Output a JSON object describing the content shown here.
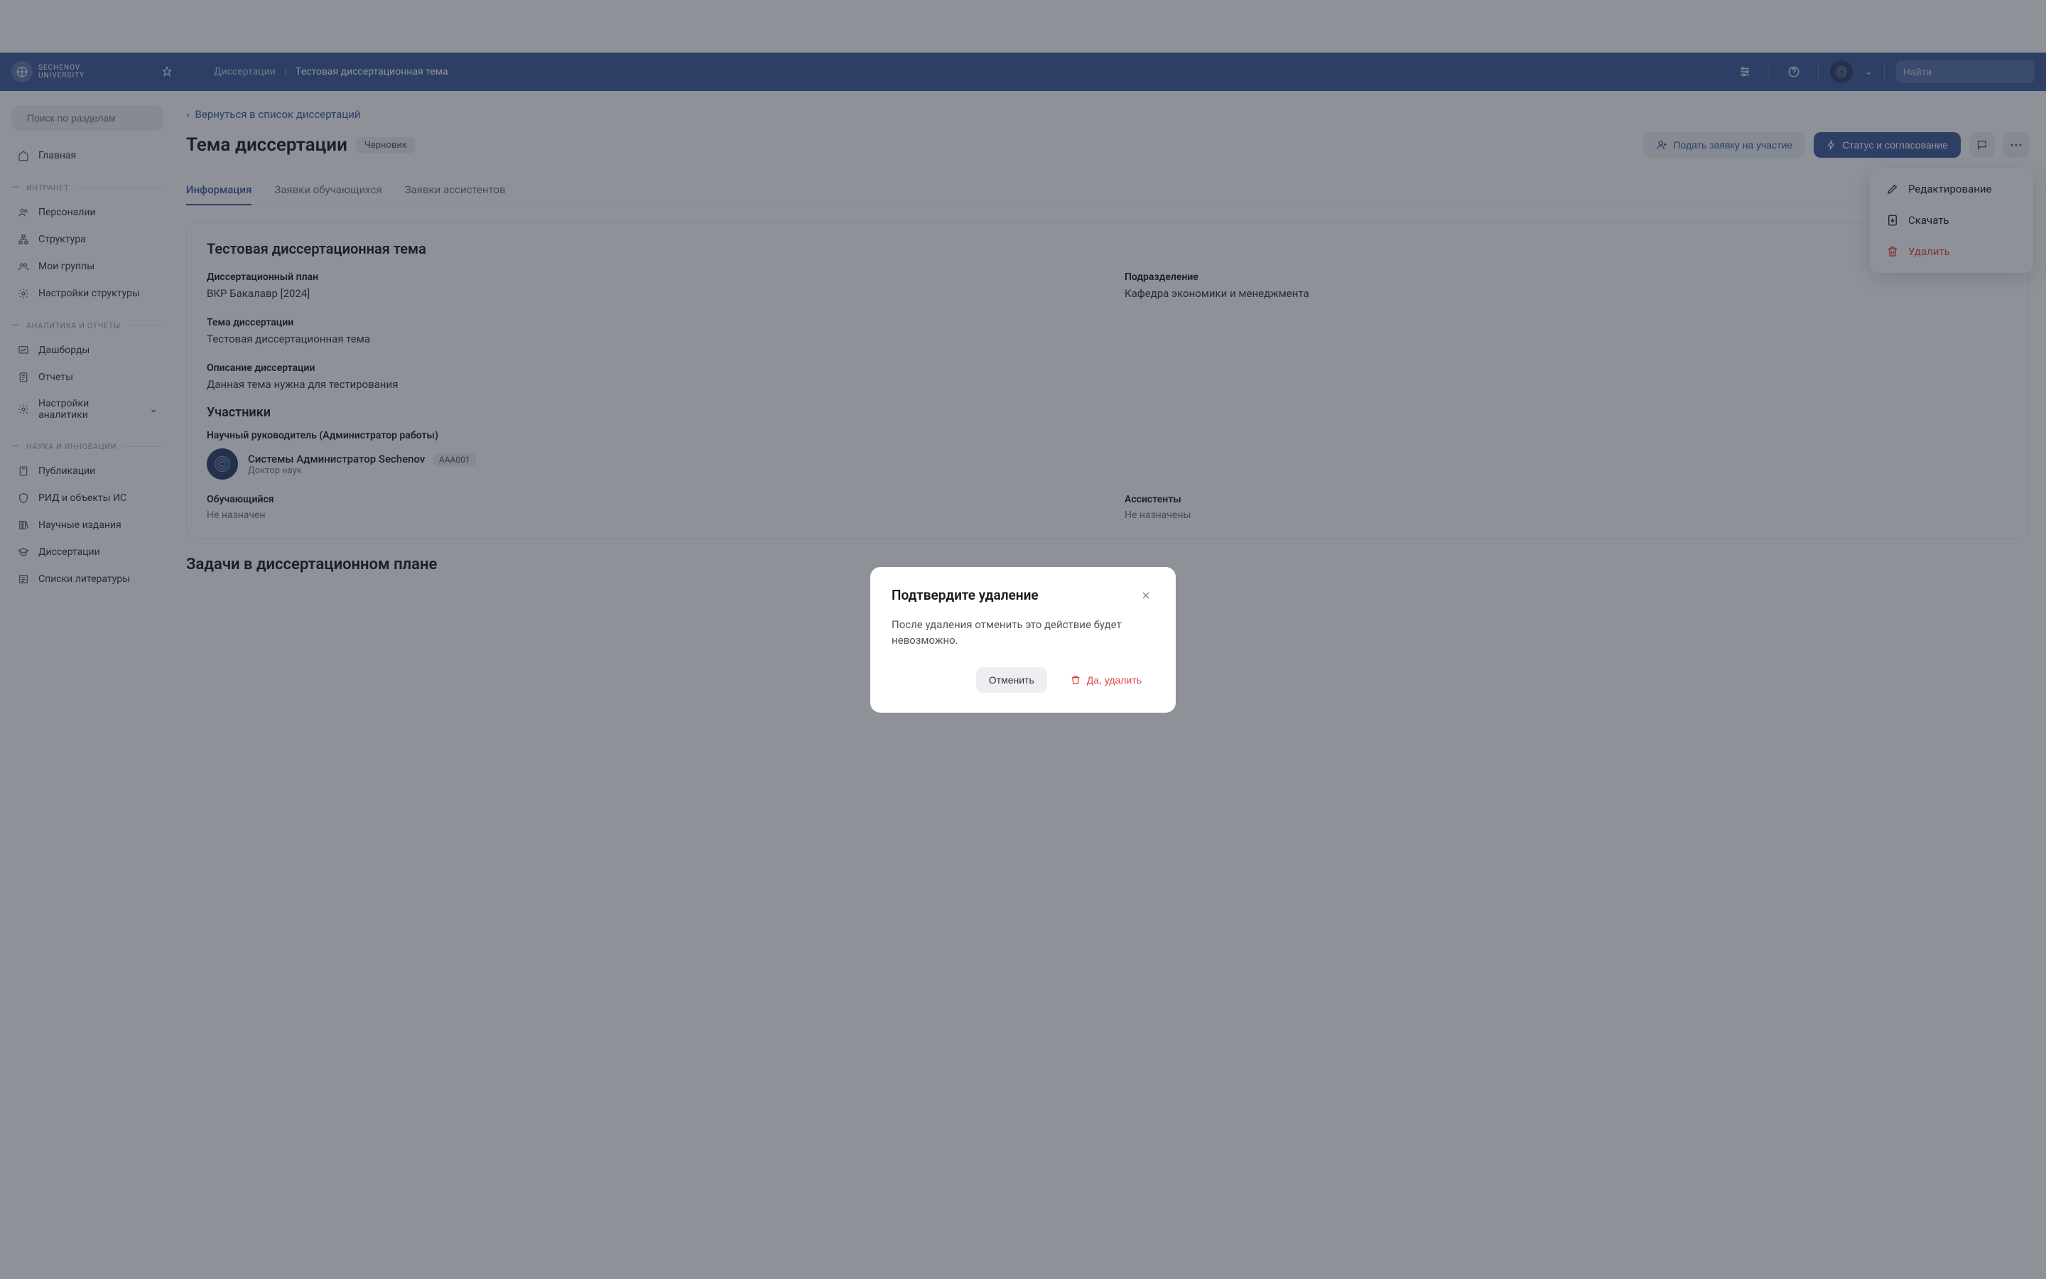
{
  "header": {
    "logo_line1": "SECHENOV",
    "logo_line2": "UNIVERSITY",
    "breadcrumb": [
      {
        "label": "Диссертации"
      },
      {
        "label": "Тестовая диссертационная тема"
      }
    ],
    "search_placeholder": "Найти"
  },
  "sidebar": {
    "search_placeholder": "Поиск по разделам",
    "home_label": "Главная",
    "sections": [
      {
        "title": "ИНТРАНЕТ",
        "items": [
          {
            "label": "Персоналии",
            "icon": "users-icon"
          },
          {
            "label": "Структура",
            "icon": "hierarchy-icon"
          },
          {
            "label": "Мои группы",
            "icon": "group-icon"
          },
          {
            "label": "Настройки структуры",
            "icon": "gear-icon"
          }
        ]
      },
      {
        "title": "АНАЛИТИКА И ОТЧЕТЫ",
        "items": [
          {
            "label": "Дашборды",
            "icon": "dashboard-icon"
          },
          {
            "label": "Отчеты",
            "icon": "report-icon"
          },
          {
            "label": "Настройки аналитики",
            "icon": "gear-icon",
            "chevron": true
          }
        ]
      },
      {
        "title": "НАУКА И ИННОВАЦИИ",
        "items": [
          {
            "label": "Публикации",
            "icon": "book-icon"
          },
          {
            "label": "РИД и объекты ИС",
            "icon": "shield-icon"
          },
          {
            "label": "Научные издания",
            "icon": "books-icon"
          },
          {
            "label": "Диссертации",
            "icon": "cap-icon"
          },
          {
            "label": "Списки литературы",
            "icon": "list-icon"
          }
        ]
      }
    ]
  },
  "page": {
    "back_label": "Вернуться в список диссертаций",
    "title": "Тема диссертации",
    "status_badge": "Черновик",
    "actions": {
      "submit_label": "Подать заявку на участие",
      "status_label": "Статус и согласование"
    },
    "tabs": [
      {
        "label": "Информация",
        "active": true
      },
      {
        "label": "Заявки обучающихся"
      },
      {
        "label": "Заявки ассистентов"
      }
    ],
    "card": {
      "title": "Тестовая диссертационная тема",
      "fields": {
        "plan_label": "Диссертационный план",
        "plan_value": "ВКР Бакалавр [2024]",
        "dept_label": "Подразделение",
        "dept_value": "Кафедра экономики и менеджмента",
        "topic_label": "Тема диссертации",
        "topic_value": "Тестовая диссертационная тема",
        "desc_label": "Описание диссертации",
        "desc_value": "Данная тема нужна для тестирования"
      },
      "participants_title": "Участники",
      "supervisor_label": "Научный руководитель (Администратор работы)",
      "supervisor": {
        "name": "Системы Администратор Sechenov",
        "code": "AAA001",
        "degree": "Доктор наук"
      },
      "student_label": "Обучающийся",
      "student_value": "Не назначен",
      "assistants_label": "Ассистенты",
      "assistants_value": "Не назначены"
    },
    "tasks_title": "Задачи в диссертационном плане"
  },
  "dropdown": {
    "edit_label": "Редактирование",
    "download_label": "Скачать",
    "delete_label": "Удалить"
  },
  "modal": {
    "title": "Подтвердите удаление",
    "body": "После удаления отменить это действие будет невозможно.",
    "cancel_label": "Отменить",
    "confirm_label": "Да, удалить"
  },
  "colors": {
    "primary": "#3d5a99",
    "danger": "#e04646"
  }
}
